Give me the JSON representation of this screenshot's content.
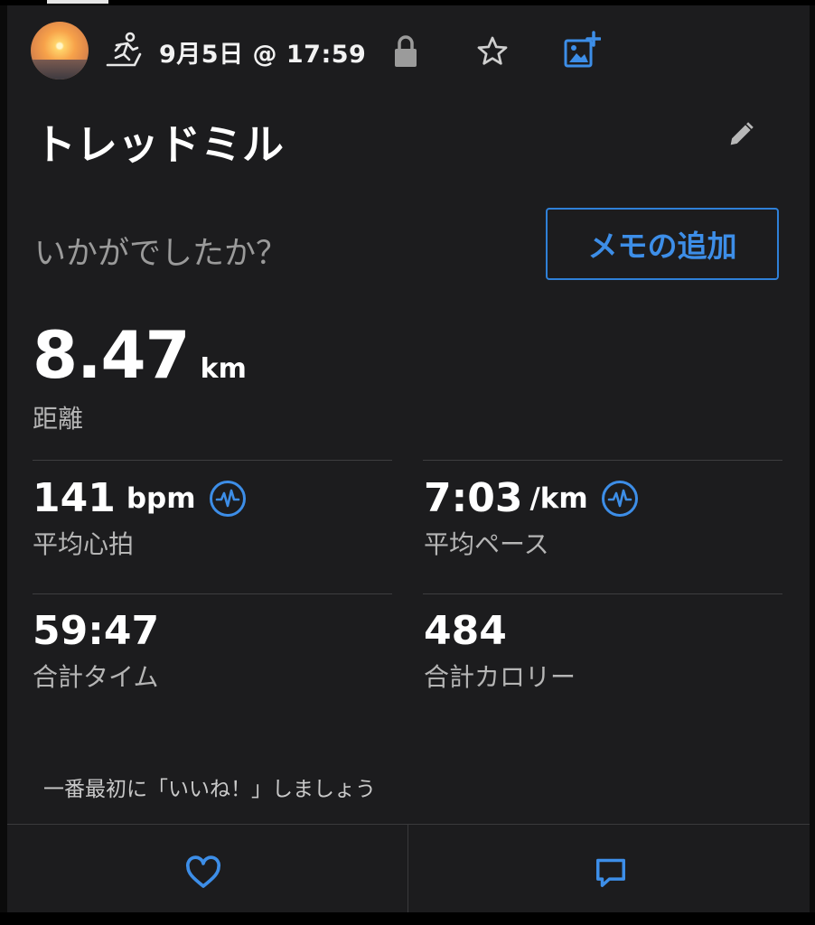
{
  "header": {
    "date": "9月5日 @ 17:59",
    "icons": [
      "avatar-photo",
      "treadmill-runner-icon",
      "lock-icon",
      "star-icon",
      "add-photo-icon"
    ]
  },
  "activity": {
    "title": "トレッドミル",
    "prompt": "いかがでしたか？",
    "memo_button": "メモの追加"
  },
  "distance": {
    "value": "8.47",
    "unit": "km",
    "label": "距離"
  },
  "stats": {
    "heart_rate": {
      "value": "141",
      "unit": "bpm",
      "label": "平均心拍"
    },
    "pace": {
      "value": "7:03",
      "unit": "/km",
      "label": "平均ペース"
    },
    "time": {
      "value": "59:47",
      "label": "合計タイム"
    },
    "calories": {
      "value": "484",
      "label": "合計カロリー"
    }
  },
  "social": {
    "like_prompt": "一番最初に「いいね！」しましょう"
  },
  "colors": {
    "accent": "#2f80d8",
    "card": "#1c1c1e",
    "background": "#0b0b0b",
    "muted": "#9a9a9a"
  }
}
